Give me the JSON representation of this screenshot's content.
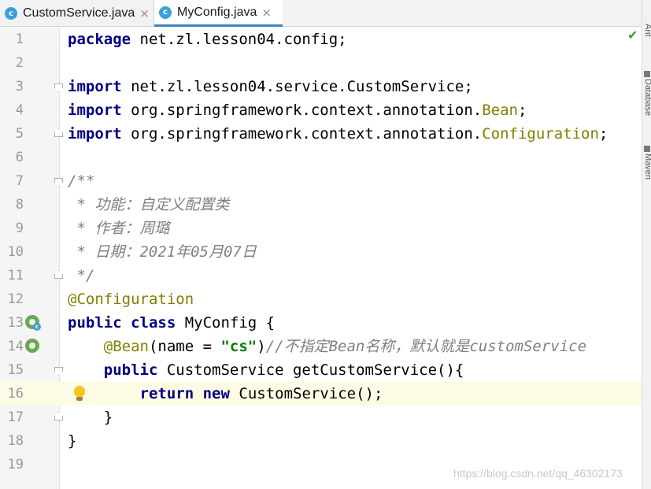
{
  "tabs": [
    {
      "name": "CustomService.java",
      "active": false
    },
    {
      "name": "MyConfig.java",
      "active": true
    }
  ],
  "tab_icon_letter": "c",
  "close_glyph": "×",
  "right_panels": [
    "Ant",
    "Database",
    "Maven"
  ],
  "status": {
    "check": "✔"
  },
  "line_numbers": [
    "1",
    "2",
    "3",
    "4",
    "5",
    "6",
    "7",
    "8",
    "9",
    "10",
    "11",
    "12",
    "13",
    "14",
    "15",
    "16",
    "17",
    "18",
    "19"
  ],
  "code": {
    "l1": {
      "kw": "package",
      "rest": " net.zl.lesson04.config;"
    },
    "l3": {
      "kw": "import",
      "rest": " net.zl.lesson04.service.CustomService;"
    },
    "l4": {
      "kw": "import",
      "rest": " org.springframework.context.annotation.",
      "ann": "Bean",
      "end": ";"
    },
    "l5": {
      "kw": "import",
      "rest": " org.springframework.context.annotation.",
      "ann": "Configuration",
      "end": ";"
    },
    "l7": {
      "cmt": "/**"
    },
    "l8": {
      "cmt": " * 功能：自定义配置类"
    },
    "l9": {
      "cmt": " * 作者：周璐"
    },
    "l10": {
      "cmt": " * 日期：2021年05月07日"
    },
    "l11": {
      "cmt": " */"
    },
    "l12": {
      "ann": "@Configuration"
    },
    "l13": {
      "kw": "public class",
      "rest": " MyConfig {"
    },
    "l14": {
      "indent": "    ",
      "ann": "@Bean",
      "a": "(name = ",
      "str": "\"cs\"",
      "b": ")",
      "cmt": "//不指定Bean名称，默认就是customService"
    },
    "l15": {
      "indent": "    ",
      "kw": "public",
      "rest": " CustomService getCustomService(){"
    },
    "l16": {
      "indent": "        ",
      "kw1": "return",
      "sp": " ",
      "kw2": "new",
      "rest": " CustomService();"
    },
    "l17": {
      "text": "    }"
    },
    "l18": {
      "text": "}"
    }
  },
  "watermark": "https://blog.csdn.net/qq_46302173",
  "colors": {
    "keyword": "#000080",
    "annotation": "#808000",
    "string": "#008000",
    "comment": "#808080",
    "accent": "#4083c9"
  }
}
